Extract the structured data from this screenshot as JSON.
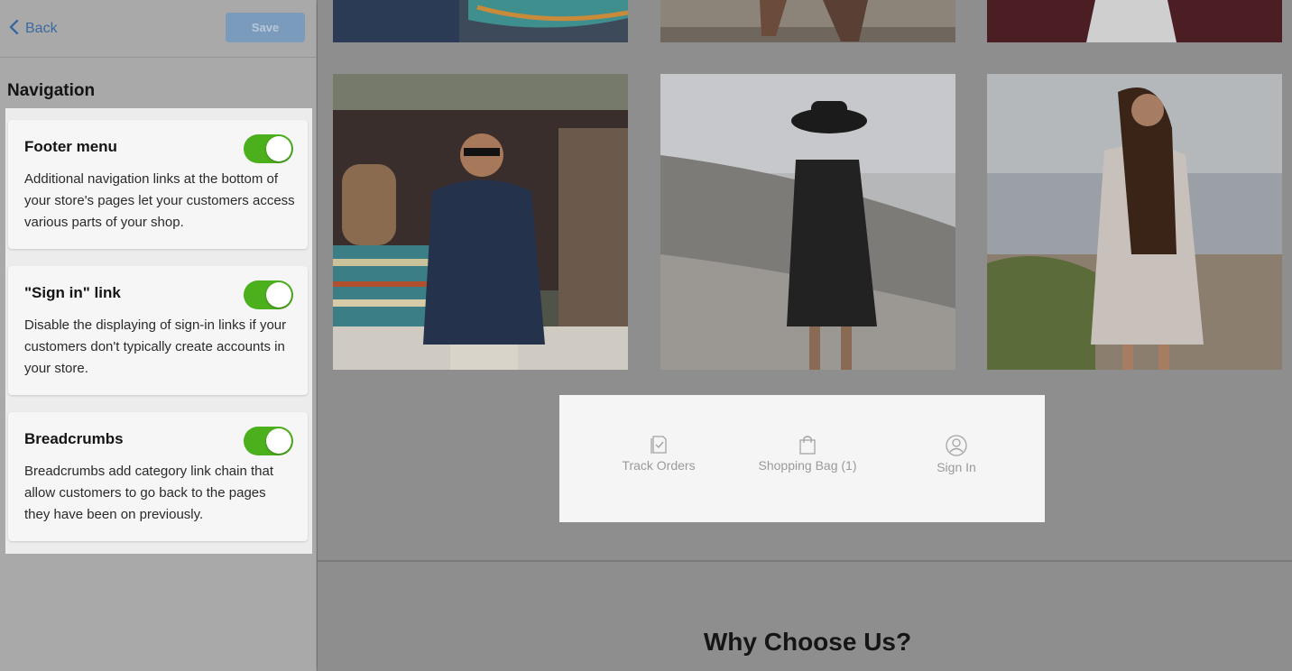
{
  "panel": {
    "back_label": "Back",
    "save_label": "Save",
    "section_title": "Navigation",
    "cards": [
      {
        "title": "Footer menu",
        "description": "Additional navigation links at the bottom of your store's pages let your customers access various parts of your shop.",
        "enabled": true
      },
      {
        "title": "\"Sign in\" link",
        "description": "Disable the displaying of sign-in links if your customers don't typically create accounts in your store.",
        "enabled": true
      },
      {
        "title": "Breadcrumbs",
        "description": "Breadcrumbs add category link chain that allow customers to go back to the pages they have been on previously.",
        "enabled": true
      }
    ]
  },
  "store": {
    "footer_menu": {
      "track_orders": {
        "label": "Track Orders",
        "icon": "clipboard-check-icon"
      },
      "shopping_bag": {
        "label": "Shopping Bag (1)",
        "icon": "shopping-bag-icon"
      },
      "sign_in": {
        "label": "Sign In",
        "icon": "user-circle-icon"
      }
    },
    "section_heading": "Why Choose Us?"
  },
  "colors": {
    "accent_blue": "#3a6aa0",
    "toggle_on": "#4caf1c",
    "save_disabled": "#7b9bbd"
  }
}
